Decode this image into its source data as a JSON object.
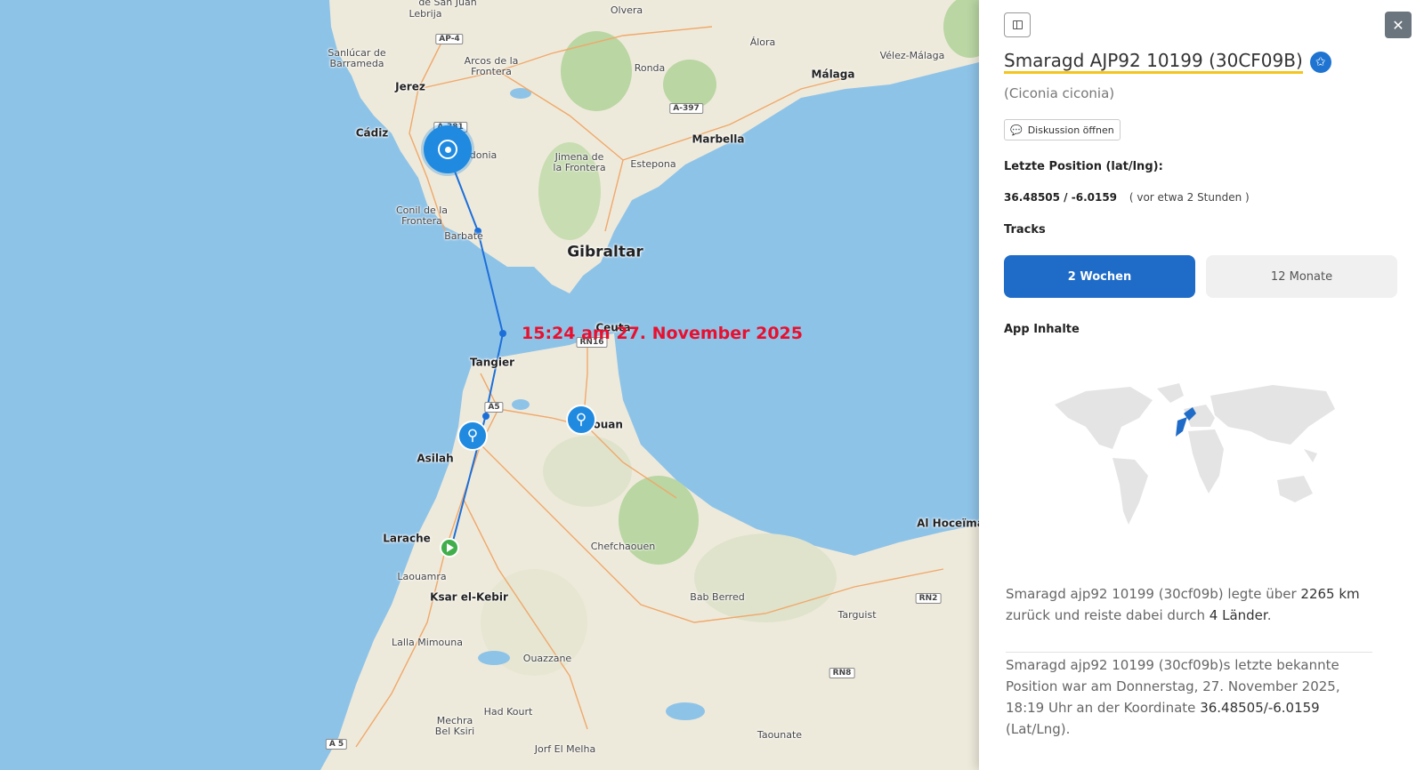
{
  "map": {
    "time_label": "15:24 am 27. November 2025",
    "places": [
      {
        "name": "Lebrija"
      },
      {
        "name": "de San Juan"
      },
      {
        "name": "Olvera"
      },
      {
        "name": "Sanlúcar de\nBarrameda"
      },
      {
        "name": "Arcos de la\nFrontera"
      },
      {
        "name": "Álora"
      },
      {
        "name": "Vélez-Málaga"
      },
      {
        "name": "Ronda"
      },
      {
        "name": "Jerez"
      },
      {
        "name": "Málaga"
      },
      {
        "name": "Cádiz"
      },
      {
        "name": "Sidonia"
      },
      {
        "name": "Jimena de\nla Frontera"
      },
      {
        "name": "Marbella"
      },
      {
        "name": "Estepona"
      },
      {
        "name": "Conil de la\nFrontera"
      },
      {
        "name": "Barbate"
      },
      {
        "name": "Gibraltar"
      },
      {
        "name": "Ceuta"
      },
      {
        "name": "Tangier"
      },
      {
        "name": "Tétouan"
      },
      {
        "name": "Asilah"
      },
      {
        "name": "Al Hoceïma"
      },
      {
        "name": "Larache"
      },
      {
        "name": "Chefchaouen"
      },
      {
        "name": "Laouamra"
      },
      {
        "name": "Ksar el-Kebir"
      },
      {
        "name": "Bab Berred"
      },
      {
        "name": "Targuist"
      },
      {
        "name": "Lalla Mimouna"
      },
      {
        "name": "Ouazzane"
      },
      {
        "name": "Had Kourt"
      },
      {
        "name": "Mechra\nBel Ksiri"
      },
      {
        "name": "Taounate"
      },
      {
        "name": "Jorf El Melha"
      }
    ],
    "roads": [
      "AP-4",
      "A-397",
      "A-381",
      "RN16",
      "A5",
      "RN2",
      "RN8",
      "A 5"
    ],
    "markers": [
      "current-position",
      "bird",
      "bird",
      "start"
    ]
  },
  "panel": {
    "title": "Smaragd AJP92 10199 (30CF09B)",
    "species": "(Ciconia ciconia)",
    "discussion_button": "Diskussion öffnen",
    "last_position_label": "Letzte Position (lat/lng):",
    "last_position_value": "36.48505 / -6.0159",
    "last_position_ago": "( vor etwa 2 Stunden )",
    "tracks_label": "Tracks",
    "tracks_options": [
      "2 Wochen",
      "12 Monate"
    ],
    "tracks_selected": "2 Wochen",
    "app_content_label": "App Inhalte",
    "summary_1": {
      "a": "Smaragd ajp92 10199 (30cf09b) legte über ",
      "distance": "2265 km",
      "b": " zurück und reiste dabei durch ",
      "countries": "4 Länder",
      "c": "."
    },
    "summary_2": {
      "a": "Smaragd ajp92 10199 (30cf09b)s letzte bekannte Position war am Donnerstag, 27. November 2025, 18:19 Uhr an der Koordinate ",
      "coord": "36.48505/-6.0159",
      "b": " (Lat/Lng)."
    },
    "close_icon": "close-icon",
    "accent_color": "#1f6cc8",
    "highlight_color": "#f4c51c"
  }
}
